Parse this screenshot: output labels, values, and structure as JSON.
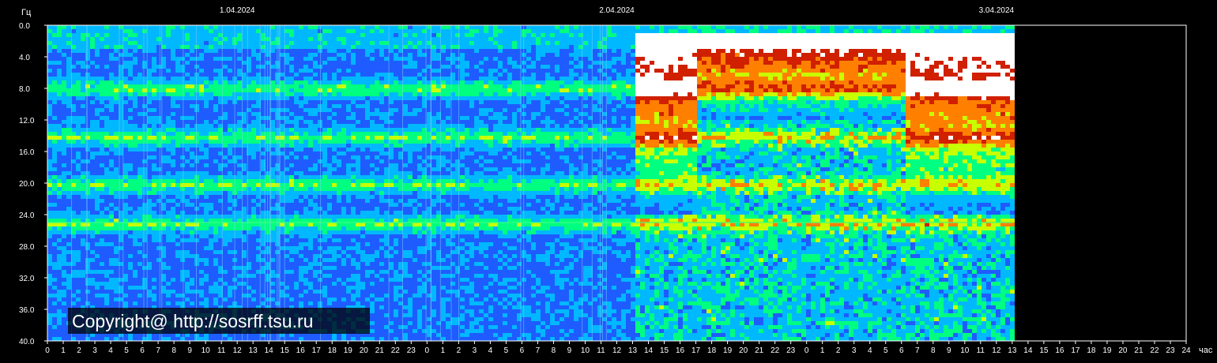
{
  "chart_data": {
    "type": "heatmap",
    "title": "",
    "ylabel": "Гц",
    "xlabel": "час",
    "ylim": [
      0,
      40
    ],
    "y_ticks": [
      "0.0",
      "4.0",
      "8.0",
      "12.0",
      "16.0",
      "20.0",
      "24.0",
      "28.0",
      "32.0",
      "36.0",
      "40.0"
    ],
    "x_tick_labels": [
      "0",
      "1",
      "2",
      "3",
      "4",
      "5",
      "6",
      "7",
      "8",
      "9",
      "10",
      "11",
      "12",
      "13",
      "14",
      "15",
      "16",
      "17",
      "18",
      "19",
      "20",
      "21",
      "22",
      "23",
      "0",
      "1",
      "2",
      "3",
      "4",
      "5",
      "6",
      "7",
      "8",
      "9",
      "10",
      "11",
      "12",
      "13",
      "14",
      "15",
      "16",
      "17",
      "18",
      "19",
      "20",
      "21",
      "22",
      "23",
      "0",
      "1",
      "2",
      "3",
      "4",
      "5",
      "6",
      "7",
      "8",
      "9",
      "10",
      "11",
      "12",
      "13",
      "14",
      "15",
      "16",
      "17",
      "18",
      "19",
      "20",
      "21",
      "22",
      "23",
      "24"
    ],
    "date_labels": [
      {
        "label": "1.04.2024",
        "hour": 12
      },
      {
        "label": "2.04.2024",
        "hour": 36
      },
      {
        "label": "3.04.2024",
        "hour": 60
      }
    ],
    "x_range_hours": [
      0,
      72
    ],
    "data_end_hour": 61,
    "intensity_change_hour": 37,
    "resonance_bands_hz": [
      7.8,
      14.0,
      20.0,
      25.0
    ],
    "colorscale": [
      "#0a1fb0",
      "#1e5cff",
      "#00b8ff",
      "#00ff80",
      "#c8ff00",
      "#ff8000",
      "#d02000",
      "#ffffff"
    ],
    "grid": false,
    "watermark": "Copyright@ http://sosrff.tsu.ru"
  }
}
